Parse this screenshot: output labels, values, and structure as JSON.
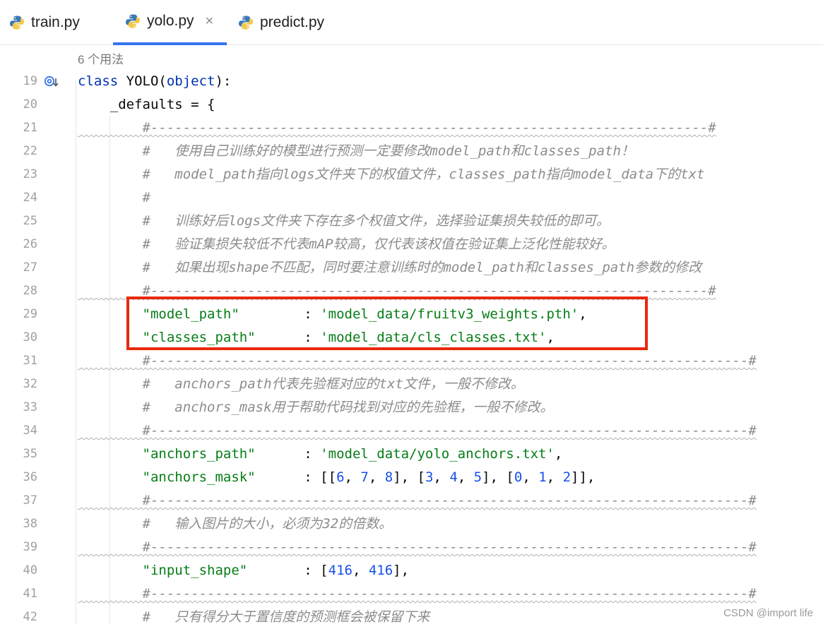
{
  "tabs": [
    {
      "label": "train.py",
      "icon": "python-icon",
      "active": false
    },
    {
      "label": "yolo.py",
      "icon": "python-icon",
      "active": true,
      "close": "×"
    },
    {
      "label": "predict.py",
      "icon": "python-icon",
      "active": false
    }
  ],
  "editor": {
    "usage_hint": "6 个用法",
    "lines": [
      {
        "n": "19",
        "parts": [
          [
            "kw",
            "class "
          ],
          [
            "",
            "YOLO("
          ],
          [
            "kw",
            "object"
          ],
          [
            "",
            "):"
          ]
        ]
      },
      {
        "n": "20",
        "parts": [
          [
            "",
            "    _defaults = {"
          ]
        ]
      },
      {
        "n": "21",
        "parts": [
          [
            "cm",
            "        #---------------------------------------------------------------------#"
          ]
        ]
      },
      {
        "n": "22",
        "parts": [
          [
            "cm",
            "        #   使用自己训练好的模型进行预测一定要修改model_path和classes_path！"
          ]
        ]
      },
      {
        "n": "23",
        "parts": [
          [
            "cm",
            "        #   model_path指向logs文件夹下的权值文件，classes_path指向model_data下的txt"
          ]
        ]
      },
      {
        "n": "24",
        "parts": [
          [
            "cm",
            "        #"
          ]
        ]
      },
      {
        "n": "25",
        "parts": [
          [
            "cm",
            "        #   训练好后logs文件夹下存在多个权值文件，选择验证集损失较低的即可。"
          ]
        ]
      },
      {
        "n": "26",
        "parts": [
          [
            "cm",
            "        #   验证集损失较低不代表mAP较高，仅代表该权值在验证集上泛化性能较好。"
          ]
        ]
      },
      {
        "n": "27",
        "parts": [
          [
            "cm",
            "        #   如果出现shape不匹配，同时要注意训练时的model_path和classes_path参数的修改"
          ]
        ]
      },
      {
        "n": "28",
        "parts": [
          [
            "cm",
            "        #---------------------------------------------------------------------#"
          ]
        ]
      },
      {
        "n": "29",
        "parts": [
          [
            "",
            "        "
          ],
          [
            "str",
            "\"model_path\""
          ],
          [
            "",
            "        : "
          ],
          [
            "str",
            "'model_data/fruitv3_weights.pth'"
          ],
          [
            "",
            ","
          ]
        ]
      },
      {
        "n": "30",
        "parts": [
          [
            "",
            "        "
          ],
          [
            "str",
            "\"classes_path\""
          ],
          [
            "",
            "      : "
          ],
          [
            "str",
            "'model_data/cls_classes.txt'"
          ],
          [
            "",
            ","
          ]
        ]
      },
      {
        "n": "31",
        "parts": [
          [
            "cm",
            "        #--------------------------------------------------------------------------#"
          ]
        ]
      },
      {
        "n": "32",
        "parts": [
          [
            "cm",
            "        #   anchors_path代表先验框对应的txt文件，一般不修改。"
          ]
        ]
      },
      {
        "n": "33",
        "parts": [
          [
            "cm",
            "        #   anchors_mask用于帮助代码找到对应的先验框，一般不修改。"
          ]
        ]
      },
      {
        "n": "34",
        "parts": [
          [
            "cm",
            "        #--------------------------------------------------------------------------#"
          ]
        ]
      },
      {
        "n": "35",
        "parts": [
          [
            "",
            "        "
          ],
          [
            "str",
            "\"anchors_path\""
          ],
          [
            "",
            "      : "
          ],
          [
            "str",
            "'model_data/yolo_anchors.txt'"
          ],
          [
            "",
            ","
          ]
        ]
      },
      {
        "n": "36",
        "parts": [
          [
            "",
            "        "
          ],
          [
            "str",
            "\"anchors_mask\""
          ],
          [
            "",
            "      : [["
          ],
          [
            "num",
            "6"
          ],
          [
            "",
            ", "
          ],
          [
            "num",
            "7"
          ],
          [
            "",
            ", "
          ],
          [
            "num",
            "8"
          ],
          [
            "",
            "], ["
          ],
          [
            "num",
            "3"
          ],
          [
            "",
            ", "
          ],
          [
            "num",
            "4"
          ],
          [
            "",
            ", "
          ],
          [
            "num",
            "5"
          ],
          [
            "",
            "], ["
          ],
          [
            "num",
            "0"
          ],
          [
            "",
            ", "
          ],
          [
            "num",
            "1"
          ],
          [
            "",
            ", "
          ],
          [
            "num",
            "2"
          ],
          [
            "",
            "]],"
          ]
        ]
      },
      {
        "n": "37",
        "parts": [
          [
            "cm",
            "        #--------------------------------------------------------------------------#"
          ]
        ]
      },
      {
        "n": "38",
        "parts": [
          [
            "cm",
            "        #   输入图片的大小，必须为32的倍数。"
          ]
        ]
      },
      {
        "n": "39",
        "parts": [
          [
            "cm",
            "        #--------------------------------------------------------------------------#"
          ]
        ]
      },
      {
        "n": "40",
        "parts": [
          [
            "",
            "        "
          ],
          [
            "str",
            "\"input_shape\""
          ],
          [
            "",
            "       : ["
          ],
          [
            "num",
            "416"
          ],
          [
            "",
            ", "
          ],
          [
            "num",
            "416"
          ],
          [
            "",
            "],"
          ]
        ]
      },
      {
        "n": "41",
        "parts": [
          [
            "cm",
            "        #--------------------------------------------------------------------------#"
          ]
        ]
      },
      {
        "n": "42",
        "parts": [
          [
            "cm",
            "        #   只有得分大于置信度的预测框会被保留下来"
          ]
        ]
      }
    ]
  },
  "watermark": "CSDN @import life",
  "colors": {
    "accent": "#3574f0",
    "highlight": "#e8290d",
    "string": "#067d17",
    "keyword": "#0033b3",
    "number": "#1750eb",
    "comment": "#8c8c8c"
  }
}
